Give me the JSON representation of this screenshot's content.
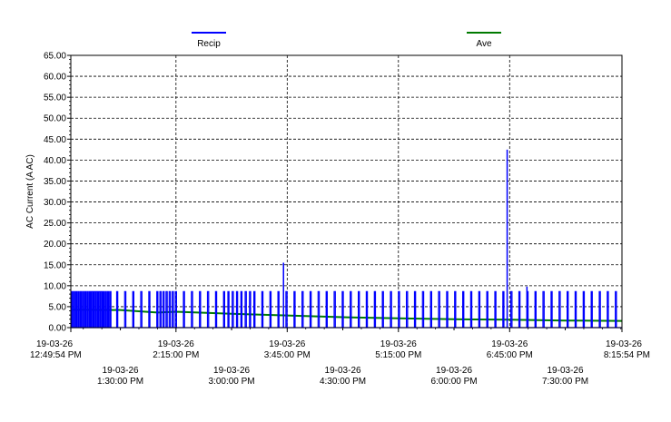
{
  "chart_data": {
    "type": "line",
    "title": "",
    "xlabel": "",
    "ylabel": "AC Current (A AC)",
    "ylim": [
      0,
      65
    ],
    "y_ticks": [
      "0.00",
      "5.00",
      "10.00",
      "15.00",
      "20.00",
      "25.00",
      "30.00",
      "35.00",
      "40.00",
      "45.00",
      "50.00",
      "55.00",
      "60.00",
      "65.00"
    ],
    "xlim": [
      "2019-03-26 12:49:54",
      "2019-03-26 20:15:54"
    ],
    "x_ticks": [
      {
        "time": "2019-03-26 12:49:54",
        "date": "19-03-26",
        "label": "12:49:54 PM"
      },
      {
        "time": "2019-03-26 13:30:00",
        "date": "19-03-26",
        "label": "1:30:00 PM"
      },
      {
        "time": "2019-03-26 14:15:00",
        "date": "19-03-26",
        "label": "2:15:00 PM"
      },
      {
        "time": "2019-03-26 15:00:00",
        "date": "19-03-26",
        "label": "3:00:00 PM"
      },
      {
        "time": "2019-03-26 15:45:00",
        "date": "19-03-26",
        "label": "3:45:00 PM"
      },
      {
        "time": "2019-03-26 16:30:00",
        "date": "19-03-26",
        "label": "4:30:00 PM"
      },
      {
        "time": "2019-03-26 17:15:00",
        "date": "19-03-26",
        "label": "5:15:00 PM"
      },
      {
        "time": "2019-03-26 18:00:00",
        "date": "19-03-26",
        "label": "6:00:00 PM"
      },
      {
        "time": "2019-03-26 18:45:00",
        "date": "19-03-26",
        "label": "6:45:00 PM"
      },
      {
        "time": "2019-03-26 19:30:00",
        "date": "19-03-26",
        "label": "7:30:00 PM"
      },
      {
        "time": "2019-03-26 20:15:54",
        "date": "19-03-26",
        "label": "8:15:54 PM"
      }
    ],
    "grid": true,
    "legend_position": "top",
    "series": [
      {
        "name": "Recip",
        "color": "#0000ff",
        "style": "cycling",
        "baseline": 0,
        "on_level": 8.6,
        "cycle_starts": [
          "12:50:20",
          "12:52:10",
          "12:54:00",
          "12:55:50",
          "12:57:40",
          "12:59:30",
          "13:01:20",
          "13:03:10",
          "13:05:00",
          "13:06:50",
          "13:08:40",
          "13:10:30",
          "13:12:20",
          "13:14:10",
          "13:16:00",
          "13:17:50",
          "13:19:40",
          "13:21:30",
          "13:27:00",
          "13:33:30",
          "13:40:00",
          "13:46:30",
          "13:53:00",
          "13:59:30",
          "14:02:00",
          "14:04:30",
          "14:07:00",
          "14:09:30",
          "14:12:00",
          "14:14:30",
          "14:21:00",
          "14:27:30",
          "14:34:00",
          "14:40:30",
          "14:47:00",
          "14:53:30",
          "14:57:00",
          "15:00:30",
          "15:04:00",
          "15:07:30",
          "15:11:00",
          "15:14:30",
          "15:18:00",
          "15:24:30",
          "15:31:00",
          "15:37:30",
          "15:44:00",
          "15:50:30",
          "15:57:00",
          "16:03:30",
          "16:10:00",
          "16:16:30",
          "16:23:00",
          "16:29:30",
          "16:36:00",
          "16:42:30",
          "16:49:00",
          "16:55:30",
          "17:02:00",
          "17:08:30",
          "17:15:00",
          "17:21:30",
          "17:28:00",
          "17:34:30",
          "17:41:00",
          "17:47:30",
          "17:54:00",
          "18:00:30",
          "18:07:00",
          "18:13:30",
          "18:20:00",
          "18:26:30",
          "18:33:00",
          "18:39:30",
          "18:46:00",
          "18:52:30",
          "18:59:00",
          "19:05:30",
          "19:12:00",
          "19:18:30",
          "19:25:00",
          "19:31:30",
          "19:38:00",
          "19:44:30",
          "19:51:00",
          "19:57:30",
          "20:04:00",
          "20:10:30"
        ],
        "on_duration_min": 0.9,
        "peaks": [
          {
            "time": "2019-03-26 15:42:00",
            "value": 15.5
          },
          {
            "time": "2019-03-26 18:43:00",
            "value": 42.5
          },
          {
            "time": "2019-03-26 18:59:00",
            "value": 9.8
          }
        ]
      },
      {
        "name": "Ave",
        "color": "#007a00",
        "style": "smooth",
        "points": [
          {
            "time": "2019-03-26 12:49:54",
            "value": 4.3
          },
          {
            "time": "2019-03-26 13:30:00",
            "value": 4.2
          },
          {
            "time": "2019-03-26 14:00:00",
            "value": 3.6
          },
          {
            "time": "2019-03-26 14:15:00",
            "value": 3.8
          },
          {
            "time": "2019-03-26 15:00:00",
            "value": 3.3
          },
          {
            "time": "2019-03-26 15:45:00",
            "value": 2.9
          },
          {
            "time": "2019-03-26 16:30:00",
            "value": 2.5
          },
          {
            "time": "2019-03-26 17:15:00",
            "value": 2.2
          },
          {
            "time": "2019-03-26 18:00:00",
            "value": 2.0
          },
          {
            "time": "2019-03-26 18:45:00",
            "value": 1.9
          },
          {
            "time": "2019-03-26 19:30:00",
            "value": 1.7
          },
          {
            "time": "2019-03-26 20:15:54",
            "value": 1.6
          }
        ]
      }
    ]
  }
}
